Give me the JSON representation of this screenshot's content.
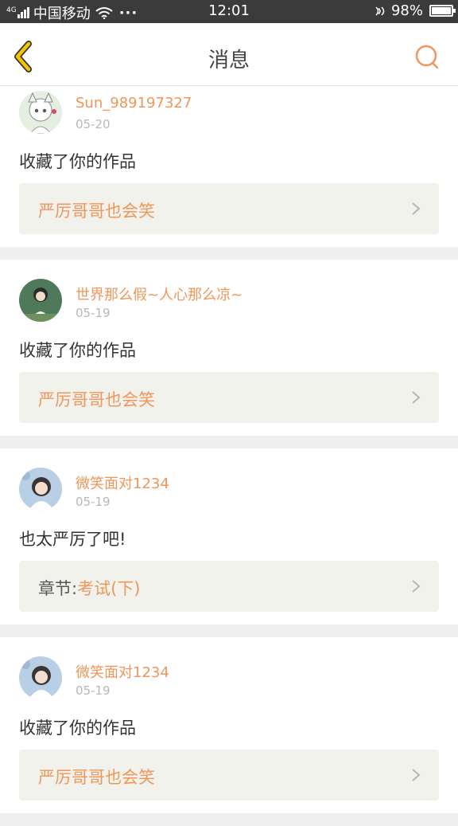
{
  "status_bar": {
    "carrier": "中国移动",
    "time": "12:01",
    "dots": "···",
    "battery_percent": "98%",
    "battery_level": 0.98,
    "signal_label": "4G"
  },
  "header": {
    "title": "消息",
    "back_icon": "chevron-left-icon",
    "search_icon": "search-icon"
  },
  "colors": {
    "accent": "#f0965a",
    "back_arrow": "#f5c400",
    "background": "#efefef",
    "card_box": "#f2f2ed"
  },
  "messages": [
    {
      "username": "Sun_989197327",
      "date": "05-20",
      "text": "收藏了你的作品",
      "work_prefix": "",
      "work_title": "严厉哥哥也会笑"
    },
    {
      "username": "世界那么假~人心那么凉~",
      "date": "05-19",
      "text": "收藏了你的作品",
      "work_prefix": "",
      "work_title": "严厉哥哥也会笑"
    },
    {
      "username": "微笑面对1234",
      "date": "05-19",
      "text": "也太严厉了吧!",
      "work_prefix": "章节:",
      "work_title": "考试(下)"
    },
    {
      "username": "微笑面对1234",
      "date": "05-19",
      "text": "收藏了你的作品",
      "work_prefix": "",
      "work_title": "严厉哥哥也会笑"
    }
  ]
}
